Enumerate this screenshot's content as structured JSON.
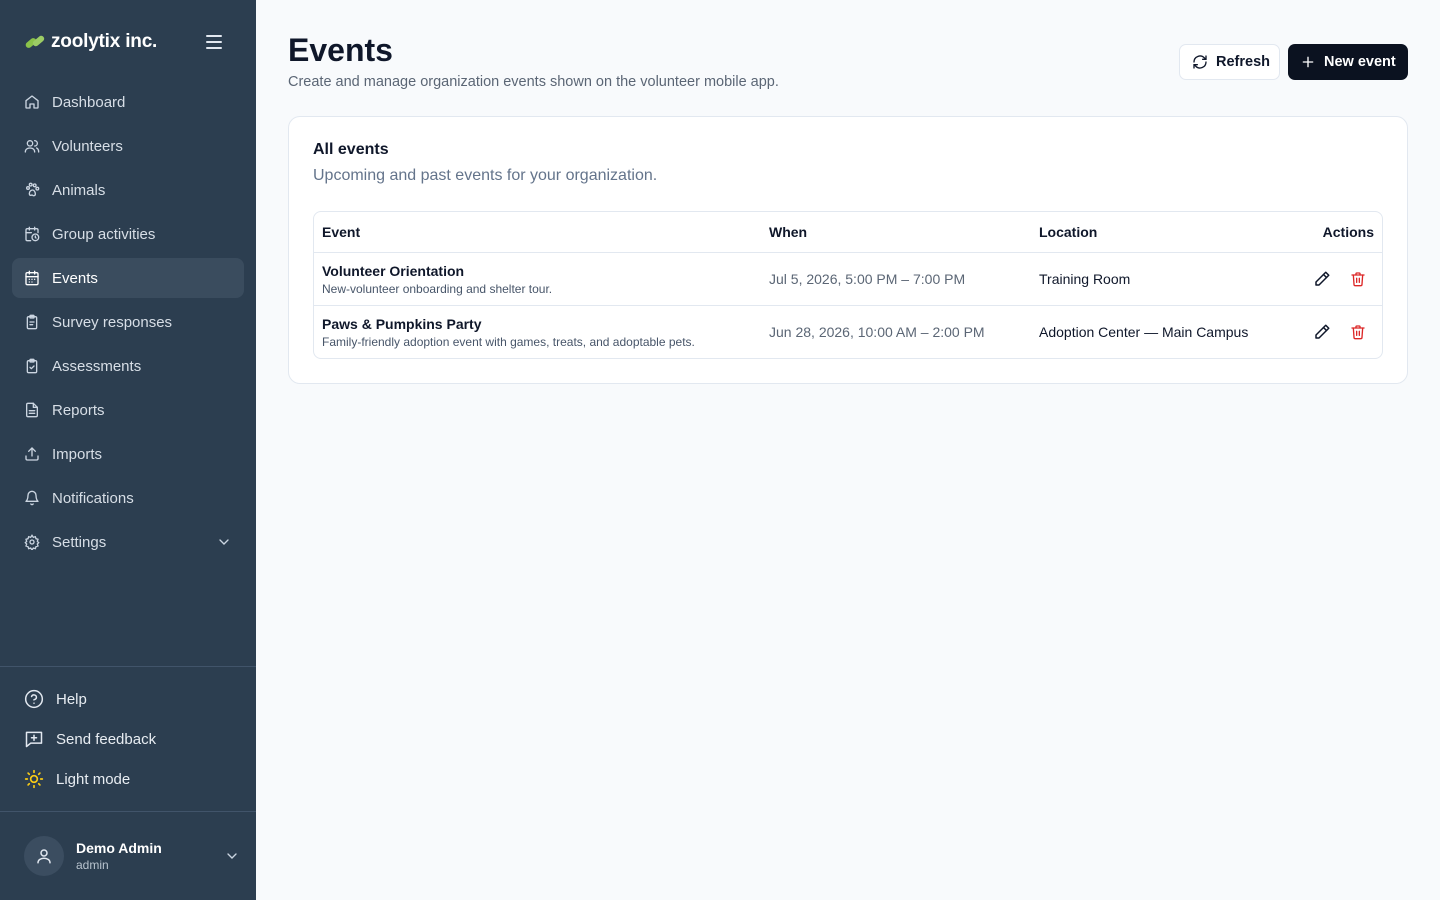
{
  "brand": {
    "name": "zoolytix inc.",
    "accent": "#8bc34a"
  },
  "sidebar": {
    "items": [
      {
        "label": "Dashboard",
        "icon": "home-icon",
        "active": false
      },
      {
        "label": "Volunteers",
        "icon": "users-icon",
        "active": false
      },
      {
        "label": "Animals",
        "icon": "paw-icon",
        "active": false
      },
      {
        "label": "Group activities",
        "icon": "calendar-clock-icon",
        "active": false
      },
      {
        "label": "Events",
        "icon": "calendar-icon",
        "active": true
      },
      {
        "label": "Survey responses",
        "icon": "clipboard-icon",
        "active": false
      },
      {
        "label": "Assessments",
        "icon": "clipboard-check-icon",
        "active": false
      },
      {
        "label": "Reports",
        "icon": "file-text-icon",
        "active": false
      },
      {
        "label": "Imports",
        "icon": "upload-icon",
        "active": false
      },
      {
        "label": "Notifications",
        "icon": "bell-icon",
        "active": false
      },
      {
        "label": "Settings",
        "icon": "gear-icon",
        "active": false
      }
    ],
    "utilities": {
      "help": "Help",
      "feedback": "Send feedback",
      "theme": "Light mode"
    },
    "user": {
      "name": "Demo Admin",
      "role": "admin"
    }
  },
  "header": {
    "title": "Events",
    "subtitle": "Create and manage organization events shown on the volunteer mobile app.",
    "refresh_label": "Refresh",
    "new_label": "New event"
  },
  "card": {
    "title": "All events",
    "subtitle": "Upcoming and past events for your organization.",
    "columns": {
      "event": "Event",
      "when": "When",
      "location": "Location",
      "actions": "Actions"
    },
    "rows": [
      {
        "name": "Volunteer Orientation",
        "description": "New-volunteer onboarding and shelter tour.",
        "when": "Jul 5, 2026, 5:00 PM – 7:00 PM",
        "location": "Training Room"
      },
      {
        "name": "Paws & Pumpkins Party",
        "description": "Family-friendly adoption event with games, treats, and adoptable pets.",
        "when": "Jun 28, 2026, 10:00 AM – 2:00 PM",
        "location": "Adoption Center — Main Campus"
      }
    ]
  },
  "colors": {
    "sidebar_bg": "#2c3e50",
    "delete": "#dc2626",
    "primary_btn": "#0b1220",
    "sun": "#facc15"
  }
}
